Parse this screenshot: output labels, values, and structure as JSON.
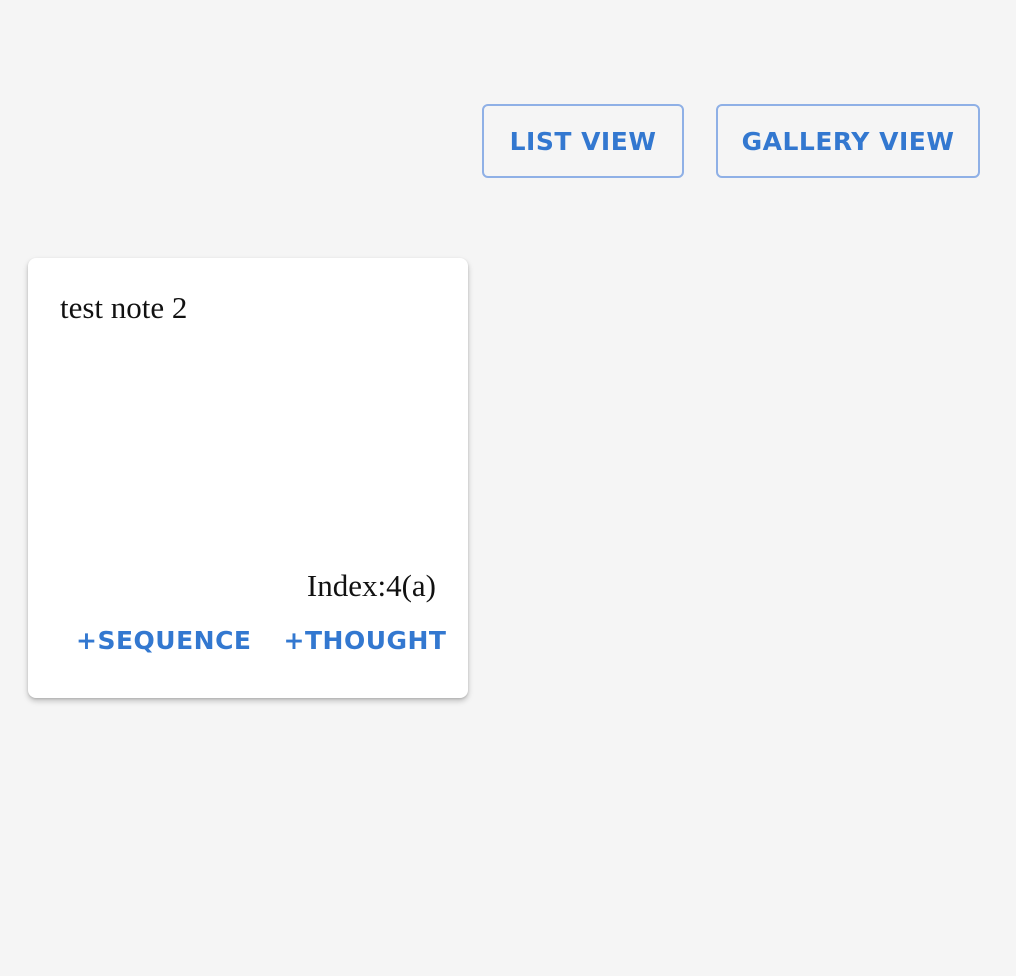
{
  "toolbar": {
    "list_view_label": "LIST VIEW",
    "gallery_view_label": "GALLERY VIEW"
  },
  "note_card": {
    "title": "test note 2",
    "index_label": "Index:4(a)",
    "add_sequence_label": "+SEQUENCE",
    "add_thought_label": "+THOUGHT"
  },
  "colors": {
    "background": "#f5f5f5",
    "accent": "#3378d0",
    "button_border": "#8fb0e6",
    "card": "#ffffff"
  }
}
